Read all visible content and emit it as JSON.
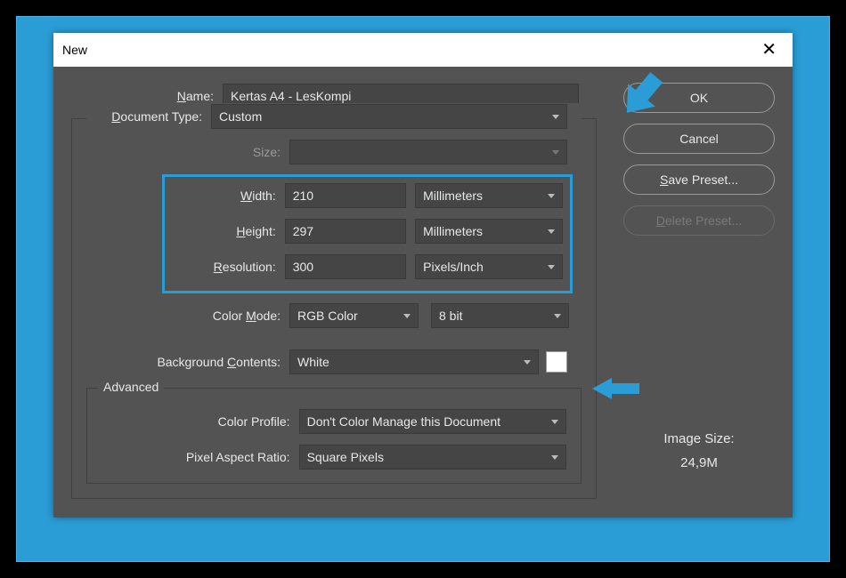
{
  "dialog": {
    "title": "New",
    "labels": {
      "name": "Name:",
      "document_type": "Document Type:",
      "size": "Size:",
      "width": "Width:",
      "height": "Height:",
      "resolution": "Resolution:",
      "color_mode": "Color Mode:",
      "bg_contents": "Background Contents:",
      "advanced": "Advanced",
      "color_profile": "Color Profile:",
      "pixel_aspect": "Pixel Aspect Ratio:"
    },
    "values": {
      "name": "Kertas A4 - LesKompi",
      "document_type": "Custom",
      "size": "",
      "width": "210",
      "width_unit": "Millimeters",
      "height": "297",
      "height_unit": "Millimeters",
      "resolution": "300",
      "resolution_unit": "Pixels/Inch",
      "color_mode": "RGB Color",
      "color_depth": "8 bit",
      "bg_contents": "White",
      "color_profile": "Don't Color Manage this Document",
      "pixel_aspect": "Square Pixels"
    },
    "buttons": {
      "ok": "OK",
      "cancel": "Cancel",
      "save_preset": "Save Preset...",
      "delete_preset": "Delete Preset..."
    },
    "image_size": {
      "label": "Image Size:",
      "value": "24,9M"
    }
  }
}
